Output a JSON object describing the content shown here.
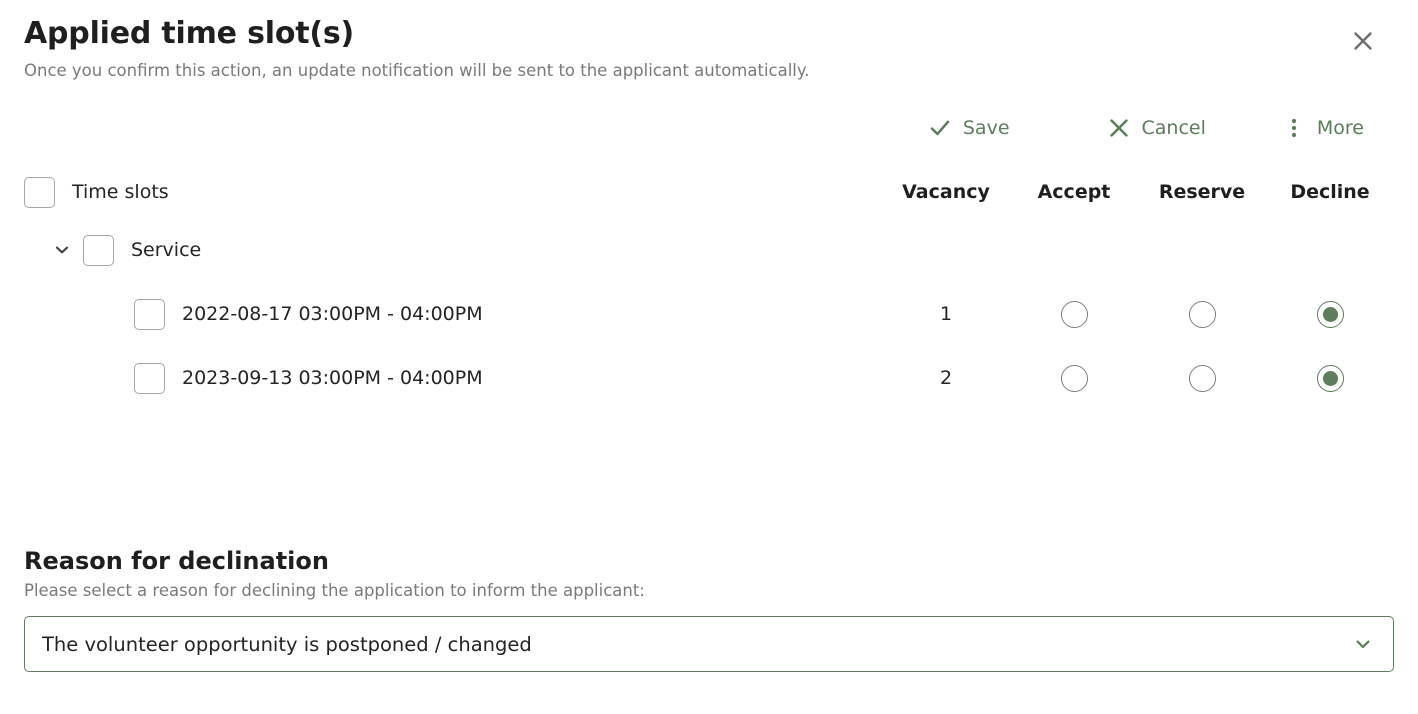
{
  "dialog": {
    "title": "Applied time slot(s)",
    "subtitle": "Once you confirm this action, an update notification will be sent to the applicant automatically.",
    "close_icon": "close-icon"
  },
  "toolbar": {
    "save_label": "Save",
    "save_icon": "check-icon",
    "cancel_label": "Cancel",
    "cancel_icon": "x-icon",
    "more_label": "More",
    "more_icon": "vertical-dots-icon"
  },
  "table": {
    "select_all_label": "Time slots",
    "columns": [
      {
        "key": "vacancy",
        "label": "Vacancy"
      },
      {
        "key": "accept",
        "label": "Accept"
      },
      {
        "key": "reserve",
        "label": "Reserve"
      },
      {
        "key": "decline",
        "label": "Decline"
      }
    ],
    "group": {
      "label": "Service",
      "expanded": true,
      "expander_icon": "chevron-down-icon",
      "checked": false
    },
    "rows": [
      {
        "label": "2022-08-17 03:00PM - 04:00PM",
        "vacancy": "1",
        "checked": false,
        "selection": "decline"
      },
      {
        "label": "2023-09-13 03:00PM - 04:00PM",
        "vacancy": "2",
        "checked": false,
        "selection": "decline"
      }
    ]
  },
  "reason": {
    "title": "Reason for declination",
    "description": "Please select a reason for declining the application to inform the applicant:",
    "selected_value": "The volunteer opportunity is postponed / changed",
    "chevron_icon": "chevron-down-icon"
  },
  "colors": {
    "accent_green": "#5d7d5c",
    "text_primary": "#242424",
    "text_muted": "#7a7a7a",
    "border_gray": "#a6a6a6"
  }
}
